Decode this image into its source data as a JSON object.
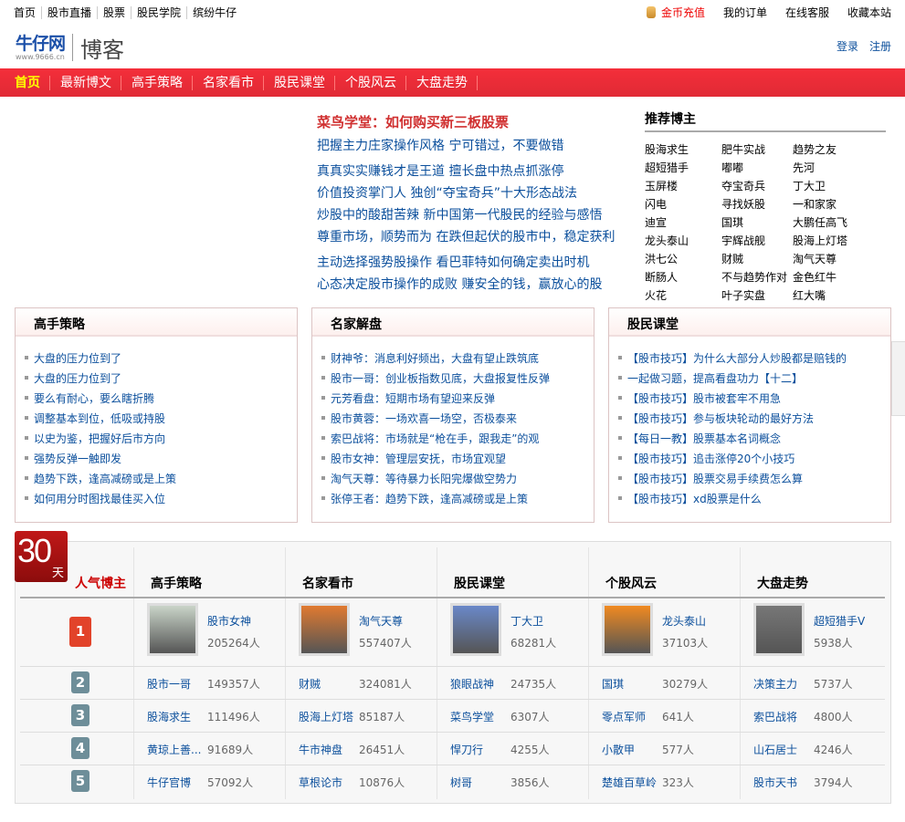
{
  "topbar": {
    "links": [
      "首页",
      "股市直播",
      "股票",
      "股民学院",
      "缤纷牛仔"
    ],
    "recharge": "金币充值",
    "orders": "我的订单",
    "service": "在线客服",
    "favorite": "收藏本站"
  },
  "logo": {
    "brand": "牛仔网",
    "url": "www.9666.cn",
    "blog": "博客"
  },
  "auth": {
    "login": "登录",
    "register": "注册"
  },
  "nav": [
    "首页",
    "最新博文",
    "高手策略",
    "名家看市",
    "股民课堂",
    "个股风云",
    "大盘走势"
  ],
  "headlines": {
    "main": "菜鸟学堂：如何购买新三板股票",
    "lines": [
      "把握主力庄家操作风格 宁可错过，不要做错",
      "真真实实赚钱才是王道 擅长盘中热点抓涨停",
      "价值投资掌门人 独创“夺宝奇兵”十大形态战法",
      "炒股中的酸甜苦辣 新中国第一代股民的经验与感悟",
      "尊重市场，顺势而为 在跌但起伏的股市中，稳定获利",
      "主动选择强势股操作 看巴菲特如何确定卖出时机",
      "心态决定股市操作的成败 赚安全的钱，赢放心的股"
    ]
  },
  "recommended": {
    "title": "推荐博主",
    "names": [
      "股海求生",
      "肥牛实战",
      "趋势之友",
      "超短猎手",
      "嘟嘟",
      "先河",
      "玉屏楼",
      "夺宝奇兵",
      "丁大卫",
      "闪电",
      "寻找妖股",
      "一和家家",
      "迪宣",
      "国琪",
      "大鹏任高飞",
      "龙头泰山",
      "宇辉战舰",
      "股海上灯塔",
      "洪七公",
      "财贼",
      "淘气天尊",
      "断肠人",
      "不与趋势作对",
      "金色红牛",
      "火花",
      "叶子实盘",
      "红大嘴"
    ]
  },
  "panels": [
    {
      "title": "高手策略",
      "items": [
        "大盘的压力位到了",
        "大盘的压力位到了",
        "要么有耐心，要么瞎折腾",
        "调整基本到位，低吸或持股",
        "以史为鉴，把握好后市方向",
        "强势反弹一触即发",
        "趋势下跌，逢高减磅或是上策",
        "如何用分时图找最佳买入位"
      ]
    },
    {
      "title": "名家解盘",
      "items": [
        "财神爷：消息利好频出，大盘有望止跌筑底",
        "股市一哥：创业板指数见底，大盘报复性反弹",
        "元芳看盘：短期市场有望迎来反弹",
        "股市黄蓉：一场欢喜一场空，否极泰来",
        "索巴战将：市场就是“枪在手，跟我走”的观",
        "股市女神：管理层安抚，市场宜观望",
        "淘气天尊：等待暴力长阳完爆做空势力",
        "张停王者：趋势下跌，逢高减磅或是上策"
      ]
    },
    {
      "title": "股民课堂",
      "items": [
        "【股市技巧】为什么大部分人炒股都是赔钱的",
        "一起做习题，提高看盘功力【十二】",
        "【股市技巧】股市被套牢不用急",
        "【股市技巧】参与板块轮动的最好方法",
        "【每日一教】股票基本名词概念",
        "【股市技巧】追击涨停20个小技巧",
        "【股市技巧】股票交易手续费怎么算",
        "【股市技巧】xd股票是什么"
      ]
    }
  ],
  "ranking": {
    "badge_number": "30",
    "badge_unit": "天",
    "label": "人气博主",
    "ranks": [
      "1",
      "2",
      "3",
      "4",
      "5"
    ],
    "columns": [
      {
        "title": "高手策略",
        "rows": [
          [
            "股市女神",
            "205264人"
          ],
          [
            "股市一哥",
            "149357人"
          ],
          [
            "股海求生",
            "111496人"
          ],
          [
            "黄琼上善...",
            "91689人"
          ],
          [
            "牛仔官博",
            "57092人"
          ]
        ]
      },
      {
        "title": "名家看市",
        "rows": [
          [
            "淘气天尊",
            "557407人"
          ],
          [
            "财贼",
            "324081人"
          ],
          [
            "股海上灯塔",
            "85187人"
          ],
          [
            "牛市神盘",
            "26451人"
          ],
          [
            "草根论市",
            "10876人"
          ]
        ]
      },
      {
        "title": "股民课堂",
        "rows": [
          [
            "丁大卫",
            "68281人"
          ],
          [
            "狼眼战神",
            "24735人"
          ],
          [
            "菜鸟学堂",
            "6307人"
          ],
          [
            "悍刀行",
            "4255人"
          ],
          [
            "树哥",
            "3856人"
          ]
        ]
      },
      {
        "title": "个股风云",
        "rows": [
          [
            "龙头泰山",
            "37103人"
          ],
          [
            "国琪",
            "30279人"
          ],
          [
            "零点军师",
            "641人"
          ],
          [
            "小散甲",
            "577人"
          ],
          [
            "楚雄百草岭",
            "323人"
          ]
        ]
      },
      {
        "title": "大盘走势",
        "rows": [
          [
            "超短猎手V",
            "5938人"
          ],
          [
            "决策主力",
            "5737人"
          ],
          [
            "索巴战将",
            "4800人"
          ],
          [
            "山石居士",
            "4246人"
          ],
          [
            "股市天书",
            "3794人"
          ]
        ]
      }
    ]
  },
  "colors": {
    "nav_red": "#f42e3a",
    "link_blue": "#0b4f9c",
    "accent_red": "#d03030"
  }
}
